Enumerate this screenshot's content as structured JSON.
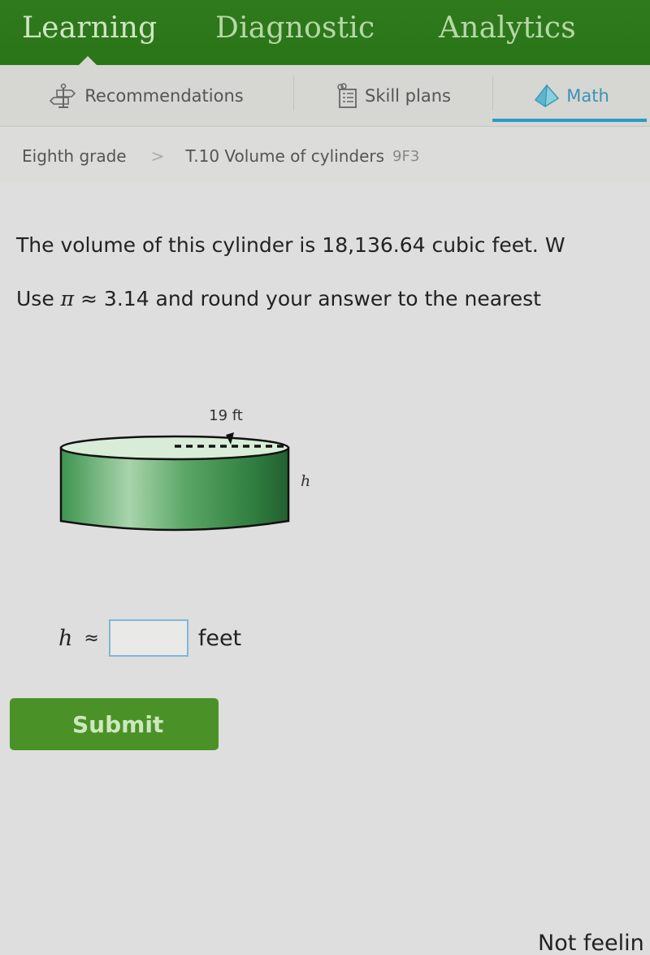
{
  "top_nav": {
    "items": [
      {
        "label": "Learning",
        "active": true
      },
      {
        "label": "Diagnostic",
        "active": false
      },
      {
        "label": "Analytics",
        "active": false
      }
    ]
  },
  "sub_nav": {
    "tabs": [
      {
        "label": "Recommendations",
        "icon": "signpost-icon",
        "active": false
      },
      {
        "label": "Skill plans",
        "icon": "clipboard-list-icon",
        "active": false
      },
      {
        "label": "Math",
        "icon": "pyramid-icon",
        "active": true
      }
    ]
  },
  "breadcrumb": {
    "grade": "Eighth grade",
    "separator": ">",
    "skill": "T.10 Volume of cylinders",
    "skill_code": "9F3"
  },
  "question": {
    "line1": "The volume of this cylinder is 18,136.64 cubic feet. W",
    "line2_prefix": "Use ",
    "pi_symbol": "π",
    "line2_suffix": " ≈ 3.14 and round your answer to the nearest"
  },
  "figure": {
    "radius_label": "19 ft",
    "height_label": "h"
  },
  "answer": {
    "variable": "h",
    "approx_symbol": "≈",
    "value": "",
    "placeholder": "",
    "unit": "feet"
  },
  "submit": {
    "label": "Submit"
  },
  "footer": {
    "not_feeling_text": "Not feelin"
  },
  "colors": {
    "nav_green": "#2f7a1d",
    "accent_blue": "#2d9ac4",
    "submit_green": "#4a9227"
  }
}
